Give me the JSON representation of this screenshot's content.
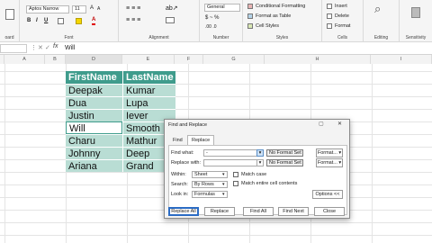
{
  "ribbon": {
    "clipboard_label": "oard",
    "font_name": "Aptos Narrow",
    "font_size": "11",
    "font_label": "Font",
    "alignment_label": "Alignment",
    "number_format": "General",
    "number_label": "Number",
    "cond_format": "Conditional Formatting",
    "format_table": "Format as Table",
    "cell_styles": "Cell Styles",
    "styles_label": "Styles",
    "insert": "Insert",
    "delete": "Delete",
    "format": "Format",
    "cells_label": "Cells",
    "editing_label": "Editing",
    "sensitivity_label": "Sensitivity",
    "bold": "B",
    "italic": "I",
    "underline": "U",
    "fontcolor": "A"
  },
  "formula_bar": {
    "name_box": "",
    "fx": "fx",
    "value": "Will"
  },
  "columns": [
    "A",
    "B",
    "C",
    "D",
    "E",
    "F",
    "G",
    "H",
    "I"
  ],
  "table": {
    "headers": [
      "FirstName",
      "LastName"
    ],
    "rows": [
      [
        "Deepak",
        "Kumar"
      ],
      [
        "Dua",
        "Lupa"
      ],
      [
        "Justin",
        "Iever"
      ],
      [
        "Will",
        "Smooth"
      ],
      [
        "Charu",
        "Mathur"
      ],
      [
        "Johnny",
        "Deep"
      ],
      [
        "Ariana",
        "Grand"
      ]
    ]
  },
  "dialog": {
    "title": "Find and Replace",
    "tab_find": "Find",
    "tab_replace": "Replace",
    "find_label": "Find what:",
    "find_value": "-",
    "replace_label": "Replace with:",
    "no_format_1": "No Format Set",
    "no_format_2": "No Format Set",
    "format_btn_1": "Format...",
    "format_btn_2": "Format...",
    "within_label": "Within:",
    "within_value": "Sheet",
    "search_label": "Search:",
    "search_value": "By Rows",
    "lookin_label": "Look in:",
    "lookin_value": "Formulas",
    "match_case": "Match case",
    "match_entire": "Match entire cell contents",
    "options_btn": "Options <<",
    "replace_all": "Replace All",
    "replace": "Replace",
    "find_all": "Find All",
    "find_next": "Find Next",
    "close": "Close"
  }
}
